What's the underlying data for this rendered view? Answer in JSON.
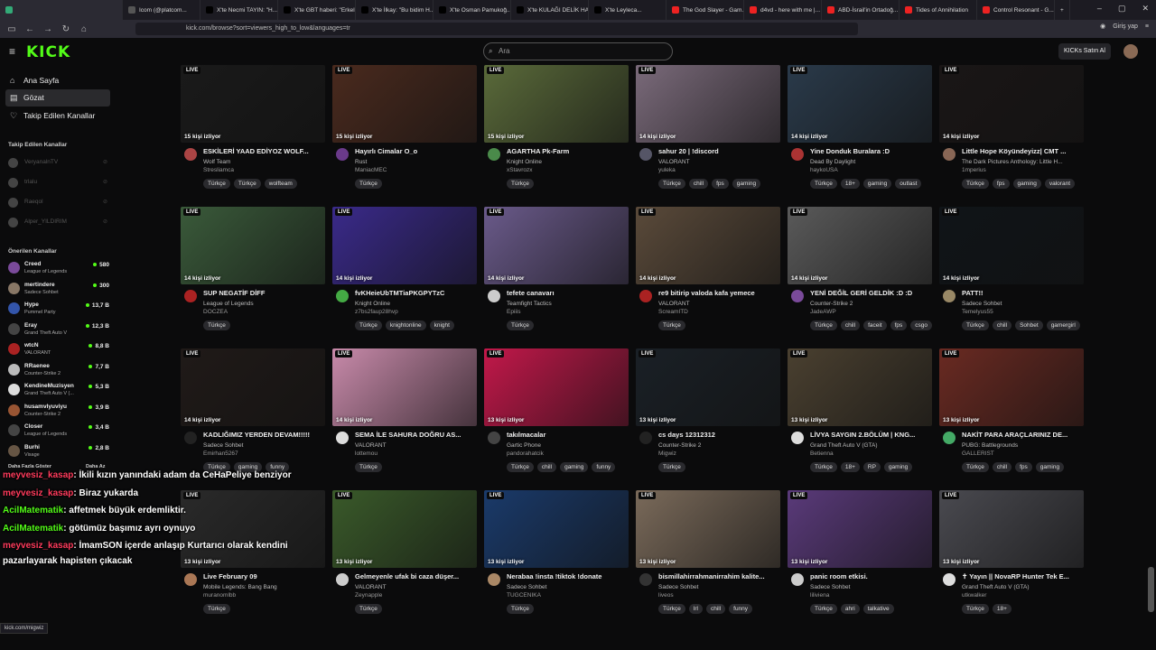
{
  "browser": {
    "tabs": [
      {
        "label": "",
        "color": "#3a7"
      },
      {
        "label": "Icom (@platcom...",
        "color": "#555"
      },
      {
        "label": "X'te Necmi TAYIN: \"H...",
        "color": "#000"
      },
      {
        "label": "X'te GBT haberi: \"Erkeli...",
        "color": "#000"
      },
      {
        "label": "X'te İlkay: \"Bu bidim H...",
        "color": "#000"
      },
      {
        "label": "X'te Osman Pamukoğ...",
        "color": "#000"
      },
      {
        "label": "X'te KULAĞI DELİK HA...",
        "color": "#000"
      },
      {
        "label": "X'te Leyleca...",
        "color": "#000"
      },
      {
        "label": "The God Slayer - Gam...",
        "color": "#e22"
      },
      {
        "label": "d4vd - here with me |...",
        "color": "#e22"
      },
      {
        "label": "ABD-İsrail'in Ortadoğ...",
        "color": "#e22"
      },
      {
        "label": "Tides of Annihilation",
        "color": "#e22"
      },
      {
        "label": "Control Resonant - G...",
        "color": "#e22"
      }
    ],
    "url": "kick.com/browse?sort=viewers_high_to_low&languages=tr",
    "signin": "Giriş yap"
  },
  "header": {
    "logo": "KICK",
    "search_placeholder": "Ara",
    "buy_label": "KICKs Satın Al"
  },
  "sidebar": {
    "menu": [
      {
        "label": "Ana Sayfa",
        "icon": "home-icon"
      },
      {
        "label": "Gözat",
        "icon": "browse-icon"
      },
      {
        "label": "Takip Edilen Kanallar",
        "icon": "heart-icon"
      }
    ],
    "followed_title": "Takip Edilen Kanallar",
    "followed": [
      "VeryanalnTV",
      "trlalu",
      "Raeqol",
      "Alper_YILDIRIM"
    ],
    "recommended_title": "Önerilen Kanallar",
    "recommended": [
      {
        "name": "Creed",
        "game": "League of Legends",
        "viewers": "580",
        "color": "#7a4a9a"
      },
      {
        "name": "mertindere",
        "game": "Sadece Sohbet",
        "viewers": "300",
        "color": "#887766"
      },
      {
        "name": "Hype",
        "game": "Pummel Party",
        "viewers": "13,7 B",
        "color": "#3355aa"
      },
      {
        "name": "Eray",
        "game": "Grand Theft Auto V",
        "viewers": "12,3 B",
        "color": "#444"
      },
      {
        "name": "wtcN",
        "game": "VALORANT",
        "viewers": "8,8 B",
        "color": "#aa2222"
      },
      {
        "name": "RRaenee",
        "game": "Counter-Strike 2",
        "viewers": "7,7 B",
        "color": "#bbb"
      },
      {
        "name": "KendineMuzisyen",
        "game": "Grand Theft Auto V (...",
        "viewers": "5,3 B",
        "color": "#ddd"
      },
      {
        "name": "husamvlyuviyu",
        "game": "Counter-Strike 2",
        "viewers": "3,9 B",
        "color": "#995533"
      },
      {
        "name": "Closer",
        "game": "League of Legends",
        "viewers": "3,4 B",
        "color": "#444"
      },
      {
        "name": "Burhi",
        "game": "Visage",
        "viewers": "2,8 B",
        "color": "#665544"
      }
    ],
    "show_more": "Daha Fazla Göster",
    "show_less": "Daha Az"
  },
  "chat": [
    {
      "user": "meyvesiz_kasap",
      "msg": ": İkili kızın yanındaki adam da CeHaPeliye benziyor",
      "green": false
    },
    {
      "user": "meyvesiz_kasap",
      "msg": ": Biraz yukarda",
      "green": false
    },
    {
      "user": "AcilMatematik",
      "msg": ": affetmek büyük erdemliktir.",
      "green": true
    },
    {
      "user": "AcilMatematik",
      "msg": ": götümüz başımız ayrı oynuyo",
      "green": true
    },
    {
      "user": "meyvesiz_kasap",
      "msg": ": İmamSON içerde anlaşıp Kurtarıcı olarak kendini",
      "green": false
    },
    {
      "user": "",
      "msg": "pazarlayarak hapisten çıkacak",
      "green": false
    }
  ],
  "status_url": "kick.com/migwiz",
  "live_label": "LIVE",
  "streams": [
    {
      "viewers": "15 kişi izliyor",
      "title": "ESKİLERİ YAAD EDİYOZ WOLF...",
      "category": "Wolf Team",
      "channel": "Stresliamca",
      "tags": [
        "Türkçe",
        "Türkçe",
        "wolfteam"
      ],
      "bg": "#1a1a1a",
      "av": "#aa4444"
    },
    {
      "viewers": "15 kişi izliyor",
      "title": "Hayırlı Cimalar O_o",
      "category": "Rust",
      "channel": "ManiacMEC",
      "tags": [
        "Türkçe"
      ],
      "bg": "#4a2a1e",
      "av": "#6a3a8a"
    },
    {
      "viewers": "15 kişi izliyor",
      "title": "AGARTHA Pk-Farm",
      "category": "Knight Online",
      "channel": "xStavrozx",
      "tags": [
        "Türkçe"
      ],
      "bg": "#5a6a3a",
      "av": "#4a8a4a"
    },
    {
      "viewers": "14 kişi izliyor",
      "title": "sahur 20 | !discord",
      "category": "VALORANT",
      "channel": "yuleka",
      "tags": [
        "Türkçe",
        "chill",
        "fps",
        "gaming"
      ],
      "bg": "#7a6a7a",
      "av": "#556"
    },
    {
      "viewers": "14 kişi izliyor",
      "title": "Yine Donduk Buralara :D",
      "category": "Dead By Daylight",
      "channel": "haykoUSA",
      "tags": [
        "Türkçe",
        "18+",
        "gaming",
        "outlast"
      ],
      "bg": "#2a3a4a",
      "av": "#aa3333"
    },
    {
      "viewers": "14 kişi izliyor",
      "title": "Little Hope Köyündeyizz| CMT ...",
      "category": "The Dark Pictures Anthology: Little H...",
      "channel": "1mperius",
      "tags": [
        "Türkçe",
        "fps",
        "gaming",
        "valorant"
      ],
      "bg": "#1a1616",
      "av": "#886655"
    },
    {
      "viewers": "14 kişi izliyor",
      "title": "SUP NEGATİF DİFF",
      "category": "League of Legends",
      "channel": "DOCZEA",
      "tags": [
        "Türkçe"
      ],
      "bg": "#3a5a3a",
      "av": "#aa2222"
    },
    {
      "viewers": "14 kişi izliyor",
      "title": "fvKHeieUbTMTiaPKGPYTzC",
      "category": "Knight Online",
      "channel": "z7bs2faup28hvp",
      "tags": [
        "Türkçe",
        "knightonline",
        "knight"
      ],
      "bg": "#3a2a8a",
      "av": "#44aa44"
    },
    {
      "viewers": "14 kişi izliyor",
      "title": "tefete canavarı",
      "category": "Teamfight Tactics",
      "channel": "Epiiis",
      "tags": [
        "Türkçe"
      ],
      "bg": "#6a5a8a",
      "av": "#ccc"
    },
    {
      "viewers": "14 kişi izliyor",
      "title": "re9 bitirip valoda kafa yemece",
      "category": "VALORANT",
      "channel": "ScreamITD",
      "tags": [
        "Türkçe"
      ],
      "bg": "#5a4a3a",
      "av": "#aa2222"
    },
    {
      "viewers": "14 kişi izliyor",
      "title": "YENİ DEĞİL GERİ GELDİK :D :D",
      "category": "Counter-Strike 2",
      "channel": "JadeAWP",
      "tags": [
        "Türkçe",
        "chill",
        "faceit",
        "fps",
        "csgo"
      ],
      "bg": "#5a5a5a",
      "av": "#7a4a9a"
    },
    {
      "viewers": "14 kişi izliyor",
      "title": "PATT!!",
      "category": "Sadece Sohbet",
      "channel": "Temelyus55",
      "tags": [
        "Türkçe",
        "chill",
        "Sohbet",
        "gamergirl"
      ],
      "bg": "#101418",
      "av": "#998866"
    },
    {
      "viewers": "14 kişi izliyor",
      "title": "KADLIĞIMIZ YERDEN DEVAM!!!!!",
      "category": "Sadece Sohbet",
      "channel": "Emirhan5267",
      "tags": [
        "Türkçe",
        "gaming",
        "funny"
      ],
      "bg": "#201a18",
      "av": "#222"
    },
    {
      "viewers": "14 kişi izliyor",
      "title": "SEMA İLE SAHURA DOĞRU AS...",
      "category": "VALORANT",
      "channel": "lottemou",
      "tags": [
        "Türkçe"
      ],
      "bg": "#c88aaa",
      "av": "#ddd"
    },
    {
      "viewers": "13 kişi izliyor",
      "title": "takılmacalar",
      "category": "Gartic Phone",
      "channel": "pandorahatcik",
      "tags": [
        "Türkçe",
        "chill",
        "gaming",
        "funny"
      ],
      "bg": "#c2184a",
      "av": "#444"
    },
    {
      "viewers": "13 kişi izliyor",
      "title": "cs days 12312312",
      "category": "Counter-Strike 2",
      "channel": "Migwiz",
      "tags": [
        "Türkçe"
      ],
      "bg": "#1a2026",
      "av": "#222"
    },
    {
      "viewers": "13 kişi izliyor",
      "title": "LİVYA SAYGIN 2.BÖLÜM | KNG...",
      "category": "Grand Theft Auto V (GTA)",
      "channel": "Betienna",
      "tags": [
        "Türkçe",
        "18+",
        "RP",
        "gaming"
      ],
      "bg": "#4a4030",
      "av": "#ddd"
    },
    {
      "viewers": "13 kişi izliyor",
      "title": "NAKİT PARA ARAÇLARINIZ DE...",
      "category": "PUBG: Battlegrounds",
      "channel": "GALLERIST",
      "tags": [
        "Türkçe",
        "chill",
        "fps",
        "gaming"
      ],
      "bg": "#6a2a22",
      "av": "#44aa66"
    },
    {
      "viewers": "13 kişi izliyor",
      "title": "Live February 09",
      "category": "Mobile Legends: Bang Bang",
      "channel": "muranomlbb",
      "tags": [
        "Türkçe"
      ],
      "bg": "#2a2a2a",
      "av": "#aa7755"
    },
    {
      "viewers": "13 kişi izliyor",
      "title": "Gelmeyenle ufak bi caza düşer...",
      "category": "VALORANT",
      "channel": "Zeynapple",
      "tags": [
        "Türkçe"
      ],
      "bg": "#3a5a2a",
      "av": "#ccc"
    },
    {
      "viewers": "13 kişi izliyor",
      "title": "Nerabaa !insta !tiktok !donate",
      "category": "Sadece Sohbet",
      "channel": "TUGCENIKA",
      "tags": [
        "Türkçe"
      ],
      "bg": "#1a3a6a",
      "av": "#aa8866"
    },
    {
      "viewers": "13 kişi izliyor",
      "title": "bismillahirrahmanirrahim kalite...",
      "category": "Sadece Sohbet",
      "channel": "liveos",
      "tags": [
        "Türkçe",
        "lrl",
        "chill",
        "funny"
      ],
      "bg": "#7a6a5a",
      "av": "#333"
    },
    {
      "viewers": "13 kişi izliyor",
      "title": "panic room etkisi.",
      "category": "Sadece Sohbet",
      "channel": "liliviena",
      "tags": [
        "Türkçe",
        "ahri",
        "talkative"
      ],
      "bg": "#5a3a7a",
      "av": "#ccc"
    },
    {
      "viewers": "13 kişi izliyor",
      "title": "✝ Yayın || NovaRP Hunter Tek E...",
      "category": "Grand Theft Auto V (GTA)",
      "channel": "utkwalker",
      "tags": [
        "Türkçe",
        "18+"
      ],
      "bg": "#4a4a50",
      "av": "#ddd"
    }
  ]
}
